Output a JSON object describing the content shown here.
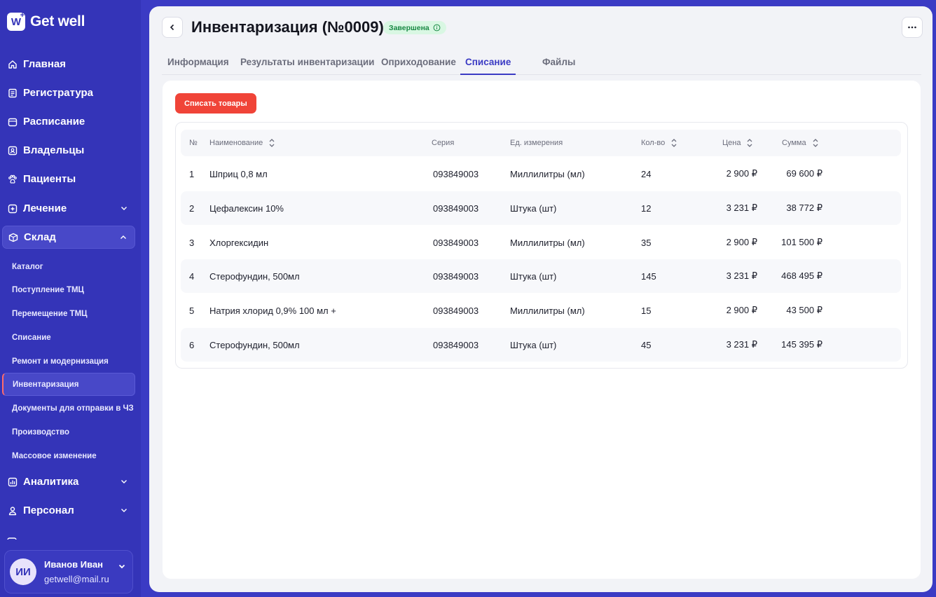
{
  "app": {
    "logo_mark": "W",
    "name": "Get well"
  },
  "sidebar": {
    "items": [
      {
        "label": "Главная",
        "icon": "home-icon"
      },
      {
        "label": "Регистратура",
        "icon": "register-icon"
      },
      {
        "label": "Расписание",
        "icon": "calendar-icon"
      },
      {
        "label": "Владельцы",
        "icon": "owners-icon"
      },
      {
        "label": "Пациенты",
        "icon": "paw-icon"
      },
      {
        "label": "Лечение",
        "icon": "plus-square-icon"
      },
      {
        "label": "Склад",
        "icon": "box-icon"
      }
    ],
    "sub_items": [
      "Каталог",
      "Поступление ТМЦ",
      "Перемещение ТМЦ",
      "Списание",
      "Ремонт и модернизация",
      "Инвентаризация",
      "Документы для отправки в ЧЗ",
      "Производство",
      "Массовое изменение"
    ],
    "bottom_items": [
      {
        "label": "Аналитика",
        "icon": "chart-icon"
      },
      {
        "label": "Персонал",
        "icon": "person-icon"
      }
    ]
  },
  "user": {
    "initials": "ИИ",
    "name": "Иванов Иван",
    "email": "getwell@mail.ru"
  },
  "header": {
    "title": "Инвентаризация (№0009)",
    "status": "Завершена"
  },
  "tabs": [
    "Информация",
    "Результаты инвентаризации",
    "Оприходование",
    "Списание",
    "Файлы"
  ],
  "actions": {
    "writeoff_label": "Списать товары"
  },
  "table": {
    "headers": {
      "num": "№",
      "name": "Наименование",
      "series": "Серия",
      "unit": "Ед. измерения",
      "qty": "Кол-во",
      "price": "Цена",
      "sum": "Сумма"
    },
    "rows": [
      [
        "1",
        "Шприц 0,8 мл",
        "093849003",
        "Миллилитры (мл)",
        "24",
        "2 900 ₽",
        "69 600 ₽"
      ],
      [
        "2",
        "Цефалексин 10%",
        "093849003",
        "Штука (шт)",
        "12",
        "3 231 ₽",
        "38 772 ₽"
      ],
      [
        "3",
        "Хлоргексидин",
        "093849003",
        "Миллилитры (мл)",
        "35",
        "2 900 ₽",
        "101 500 ₽"
      ],
      [
        "4",
        "Стерофундин, 500мл",
        "093849003",
        "Штука (шт)",
        "145",
        "3 231 ₽",
        "468 495 ₽"
      ],
      [
        "5",
        "Натрия хлорид 0,9% 100 мл +",
        "093849003",
        "Миллилитры (мл)",
        "15",
        "2 900 ₽",
        "43 500 ₽"
      ],
      [
        "6",
        "Стерофундин, 500мл",
        "093849003",
        "Штука (шт)",
        "45",
        "3 231 ₽",
        "145 395 ₽"
      ]
    ]
  },
  "colors": {
    "sidebar_bg": "#3434b8",
    "accent": "#3b3bc4",
    "danger": "#f04438",
    "success_bg": "#d9f7e3",
    "success_text": "#1a8a45"
  }
}
